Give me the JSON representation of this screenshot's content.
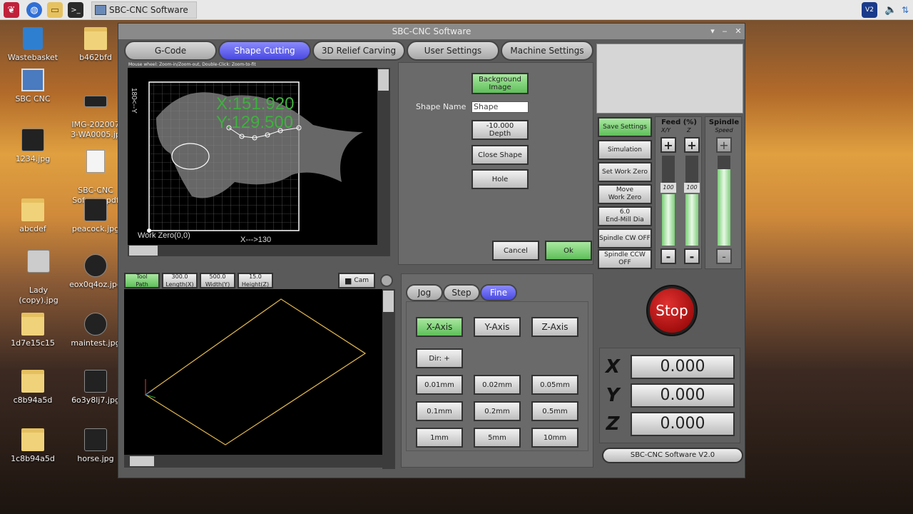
{
  "taskbar": {
    "task_label": "SBC-CNC Software"
  },
  "desktop": {
    "icons_left": [
      {
        "label": "Wastebasket"
      },
      {
        "label": "SBC CNC"
      },
      {
        "label": "1234.jpg"
      },
      {
        "label": "abcdef"
      },
      {
        "label": "Lady\n(copy).jpg"
      },
      {
        "label": "1d7e15c15"
      },
      {
        "label": "c8b94a5d"
      },
      {
        "label": "1c8b94a5d"
      }
    ],
    "icons_right": [
      {
        "label": "b462bfd"
      },
      {
        "label": "IMG-202007\n3-WA0005.jp"
      },
      {
        "label": "SBC-CNC\nSofware.pdf"
      },
      {
        "label": "peacock.jpg"
      },
      {
        "label": "eox0q4oz.jpg"
      },
      {
        "label": "maintest.jpg"
      },
      {
        "label": "6o3y8lj7.jpg"
      },
      {
        "label": "horse.jpg"
      }
    ]
  },
  "window": {
    "title": "SBC-CNC Software",
    "tabs": [
      "G-Code",
      "Shape Cutting",
      "3D Relief Carving",
      "User Settings",
      "Machine Settings"
    ],
    "active_tab": "Shape Cutting",
    "hint": "Mouse wheel: Zoom-in/Zoom-out, Double-Click: Zoom-to-fit",
    "canvas": {
      "y_label": "180<--Y",
      "coord_x": "X:151.920",
      "coord_y": "Y:129.500",
      "work_zero": "Work Zero(0,0)",
      "x_label": "X--->130"
    },
    "shape_panel": {
      "background_image": "Background\nImage",
      "shape_name_label": "Shape Name",
      "shape_name_value": "Shape",
      "depth": "-10.000\nDepth",
      "close_shape": "Close Shape",
      "hole": "Hole",
      "cancel": "Cancel",
      "ok": "Ok"
    },
    "toolpath_bar": {
      "tool_path": "Tool\nPath",
      "length": "300.0\nLength(X)",
      "width": "500.0\nWidth(Y)",
      "height": "15.0\nHeight(Z)",
      "cam": "Cam"
    },
    "jog": {
      "modes": [
        "Jog",
        "Step",
        "Fine"
      ],
      "active_mode": "Fine",
      "axes": [
        "X-Axis",
        "Y-Axis",
        "Z-Axis"
      ],
      "direction": "Dir: +",
      "steps": [
        "0.01mm",
        "0.02mm",
        "0.05mm",
        "0.1mm",
        "0.2mm",
        "0.5mm",
        "1mm",
        "5mm",
        "10mm"
      ]
    },
    "side_buttons": {
      "save_settings": "Save Settings",
      "simulation": "Simulation",
      "set_work_zero": "Set Work Zero",
      "move_work_zero": "Move\nWork Zero",
      "end_mill": "6.0\nEnd-Mill Dia",
      "spindle_cw": "Spindle CW OFF",
      "spindle_ccw": "Spindle CCW OFF"
    },
    "feed": {
      "title": "Feed (%)",
      "xy_label": "X/Y",
      "z_label": "Z",
      "xy_value": "100",
      "z_value": "100",
      "xy_level": 1.0,
      "z_level": 1.0
    },
    "spindle": {
      "title": "Spindle",
      "subtitle": "Speed",
      "level": 0.85
    },
    "stop_label": "Stop",
    "dro": {
      "x_label": "X",
      "x_value": "0.000",
      "y_label": "Y",
      "y_value": "0.000",
      "z_label": "Z",
      "z_value": "0.000"
    },
    "version": "SBC-CNC Software V2.0"
  }
}
